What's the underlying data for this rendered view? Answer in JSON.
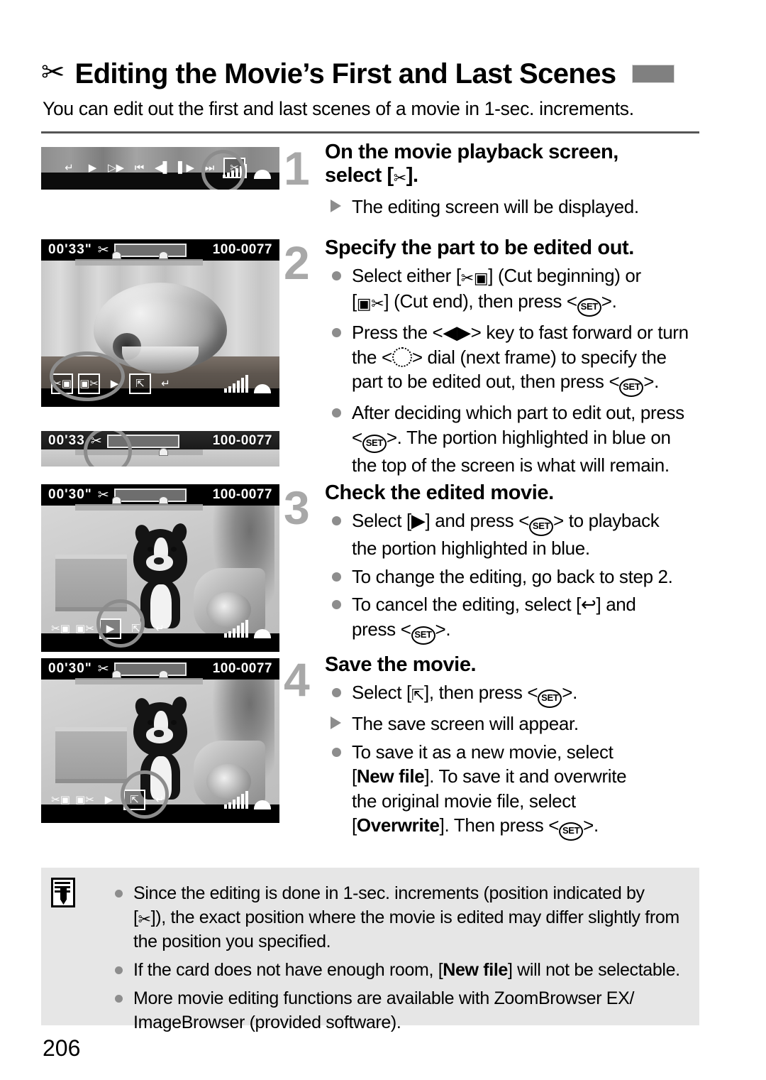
{
  "header": {
    "icon": "scissors-icon",
    "title": "Editing the Movie’s First and Last Scenes",
    "tab_color": "#808080"
  },
  "intro": "You can edit out the first and last scenes of a movie in 1-sec. increments.",
  "figures": {
    "playback_toolbar": {
      "caption_icons": [
        "return-icon",
        "play-icon",
        "slow-motion-icon",
        "first-frame-icon",
        "previous-frame-icon",
        "next-frame-icon",
        "last-frame-icon",
        "scissors-icon",
        "volume-icon",
        "dial-icon"
      ],
      "highlighted": "scissors-icon"
    },
    "flower_screen": {
      "time": "00'33\"",
      "scissors": "✂",
      "file_number": "100-0077",
      "icons": [
        "cut-beginning-icon",
        "cut-end-icon",
        "play-icon",
        "save-icon",
        "return-icon"
      ],
      "highlighted": "cut-beginning-icon"
    },
    "thin_strip": {
      "time": "00'33",
      "file_number": "100-0077",
      "highlighted": "scissors-icon"
    },
    "dog_screen_play": {
      "time": "00'30\"",
      "file_number": "100-0077",
      "icons": [
        "cut-beginning-icon",
        "cut-end-icon",
        "play-icon",
        "save-icon",
        "return-icon"
      ],
      "highlighted": "play-icon"
    },
    "dog_screen_save": {
      "time": "00'30\"",
      "file_number": "100-0077",
      "icons": [
        "cut-beginning-icon",
        "cut-end-icon",
        "play-icon",
        "save-icon",
        "return-icon"
      ],
      "highlighted": "save-icon"
    }
  },
  "steps": [
    {
      "number": "1",
      "heading_line1": "On the movie playback screen,",
      "heading_line2_prefix": "select [",
      "heading_line2_icon": "✂",
      "heading_line2_suffix": "].",
      "bullets": [
        {
          "marker": "triangle",
          "text": "The editing screen will be displayed."
        }
      ]
    },
    {
      "number": "2",
      "heading": "Specify the part to be edited out.",
      "bullets": [
        {
          "marker": "dot",
          "text": "Select either [✂🎞] (Cut beginning) or [🎞✂] (Cut end), then press <SET>."
        },
        {
          "marker": "dot",
          "text": "Press the <◀▶> key to fast forward or turn the <dial> dial (next frame) to specify the part to be edited out, then press <SET>."
        },
        {
          "marker": "dot",
          "text": "After deciding which part to edit out, press <SET>. The portion highlighted in blue on the top of the screen is what will remain."
        }
      ]
    },
    {
      "number": "3",
      "heading": "Check the edited movie.",
      "bullets": [
        {
          "marker": "dot",
          "text": "Select [▶] and press <SET> to playback the portion highlighted in blue."
        },
        {
          "marker": "dot",
          "text": "To change the editing, go back to step 2."
        },
        {
          "marker": "dot",
          "text": "To cancel the editing, select [↩] and press <SET>."
        }
      ]
    },
    {
      "number": "4",
      "heading": "Save the movie.",
      "bullets": [
        {
          "marker": "dot",
          "text": "Select [save-icon], then press <SET>."
        },
        {
          "marker": "triangle",
          "text": "The save screen will appear."
        },
        {
          "marker": "dot",
          "text": "To save it as a new movie, select [New file]. To save it and overwrite the original movie file, select [Overwrite]. Then press <SET>."
        }
      ]
    }
  ],
  "note": {
    "icon": "memo-icon",
    "items": [
      "Since the editing is done in 1-sec. increments (position indicated by [✂]), the exact position where the movie is edited may differ slightly from the position you specified.",
      "If the card does not have enough room, [New file] will not be selectable.",
      "More movie editing functions are available with ZoomBrowser EX/ImageBrowser (provided software)."
    ]
  },
  "page_number": "206",
  "labels": {
    "set_key": "SET",
    "new_file": "New file",
    "overwrite": "Overwrite"
  },
  "step2_text": {
    "b1_a": "Select either [",
    "b1_b": "] (Cut beginning) or",
    "b1_c": "] (Cut end), then press <",
    "b1_d": ">.",
    "b2_a": "Press the <◀▶> key to fast forward or turn",
    "b2_b": "the <",
    "b2_c": "> dial (next frame) to specify the",
    "b2_d": "part to be edited out, then press <",
    "b2_e": ">.",
    "b3_a": "After deciding which part to edit out, press",
    "b3_b": "<",
    "b3_c": ">. The portion highlighted in blue on",
    "b3_d": "the top of the screen is what will remain."
  },
  "step3_text": {
    "b1_a": "Select [▶] and press <",
    "b1_b": "> to playback",
    "b1_c": "the portion highlighted in blue.",
    "b2": "To change the editing, go back to step 2.",
    "b3_a": "To cancel the editing, select [↩] and",
    "b3_b": "press <",
    "b3_c": ">."
  },
  "step4_text": {
    "b1_a": "Select [",
    "b1_b": "], then press <",
    "b1_c": ">.",
    "b2": "The save screen will appear.",
    "b3_a": "To save it as a new movie, select",
    "b3_b": "]. To save it and overwrite",
    "b3_c": "the original movie file, select",
    "b3_d": "]. Then press <",
    "b3_e": ">."
  },
  "note_text": {
    "i1_a": "Since the editing is done in 1-sec. increments (position indicated by",
    "i1_b": "]), the exact position where the movie is edited may differ slightly from",
    "i1_c": "the position you specified.",
    "i2_a": "If the card does not have enough room, [",
    "i2_b": "] will not be selectable.",
    "i3_a": "More movie editing functions are available with ZoomBrowser EX/",
    "i3_b": "ImageBrowser (provided software)."
  }
}
